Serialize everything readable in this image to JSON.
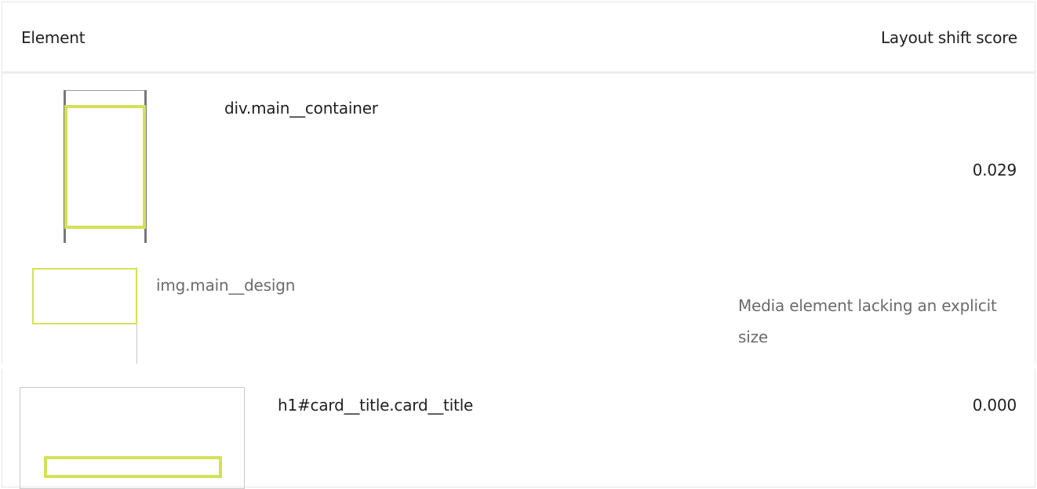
{
  "table": {
    "headers": {
      "element": "Element",
      "score": "Layout shift score"
    },
    "rows": [
      {
        "selector": "div.main__container",
        "score": "0.029",
        "sub_items": [
          {
            "selector": "img.main__design",
            "note": "Media element lacking an explicit size"
          }
        ]
      },
      {
        "selector": "h1#card__title.card__title",
        "score": "0.000"
      }
    ]
  },
  "colors": {
    "highlight": "#d4e157",
    "muted_text": "#6b6b6b",
    "text": "#212121"
  }
}
